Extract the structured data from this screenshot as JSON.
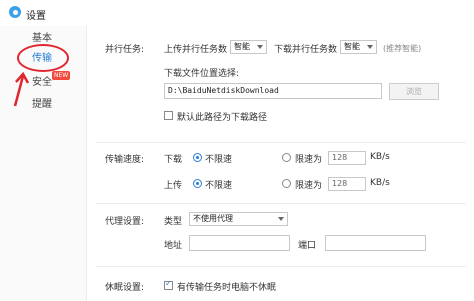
{
  "window": {
    "title": "设置"
  },
  "sidebar": {
    "items": [
      {
        "label": "基本"
      },
      {
        "label": "传输"
      },
      {
        "label": "安全"
      },
      {
        "label": "提醒"
      }
    ],
    "badge": "NEW"
  },
  "parallel": {
    "section_label": "并行任务:",
    "upload_label": "上传并行任务数",
    "upload_value": "智能",
    "download_label": "下载并行任务数",
    "download_value": "智能",
    "hint": "(推荐智能)"
  },
  "download_location": {
    "label": "下载文件位置选择:",
    "path": "D:\\BaiduNetdiskDownload",
    "browse_label": "浏览",
    "default_checkbox_label": "默认此路径为下载路径"
  },
  "speed": {
    "section_label": "传输速度:",
    "download_label": "下载",
    "upload_label": "上传",
    "unlimited_label": "不限速",
    "limit_label": "限速为",
    "download_limit": "128",
    "upload_limit": "128",
    "unit": "KB/s"
  },
  "proxy": {
    "section_label": "代理设置:",
    "type_label": "类型",
    "type_value": "不使用代理",
    "address_label": "地址",
    "port_label": "端口"
  },
  "sleep": {
    "section_label": "休眠设置:",
    "checkbox_label": "有传输任务时电脑不休眠"
  },
  "colors": {
    "accent": "#2a7fd4",
    "annotation": "#e0262e",
    "badge": "#f24a3d"
  }
}
